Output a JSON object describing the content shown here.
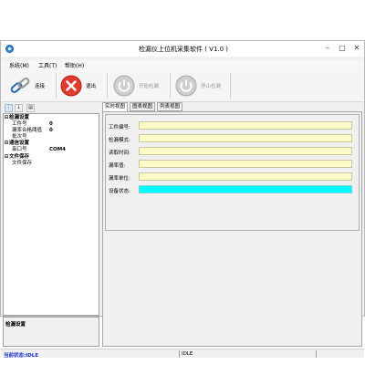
{
  "window": {
    "title": "检漏仪上位机采集软件 ( V1.0 )"
  },
  "menu": {
    "items": [
      "系统(M)",
      "工具(T)",
      "帮助(H)"
    ]
  },
  "toolbar": {
    "connect_label": "连接",
    "exit_label": "退出",
    "start_label": "开始检漏",
    "stop_label": "停止检漏"
  },
  "propgrid": {
    "categories": [
      {
        "name": "检漏设置",
        "props": [
          {
            "name": "工件号",
            "value": "0"
          },
          {
            "name": "漏率合格阈值",
            "value": "0"
          },
          {
            "name": "批次号",
            "value": ""
          }
        ]
      },
      {
        "name": "通信设置",
        "props": [
          {
            "name": "串口号",
            "value": "COM4"
          }
        ]
      },
      {
        "name": "文件保存",
        "props": [
          {
            "name": "文件保存",
            "value": ""
          }
        ]
      }
    ],
    "description_title": "检漏设置"
  },
  "tabs": [
    "实时视图",
    "图表视图",
    "列表视图"
  ],
  "fields": [
    {
      "label": "工件编号:",
      "value": ""
    },
    {
      "label": "检漏模式:",
      "value": ""
    },
    {
      "label": "读取时间:",
      "value": ""
    },
    {
      "label": "漏率值:",
      "value": ""
    },
    {
      "label": "漏率单位:",
      "value": ""
    },
    {
      "label": "设备状态:",
      "value": ""
    }
  ],
  "status": {
    "left": "当前状态:IDLE",
    "right": "IDLE"
  },
  "colors": {
    "field_bg": "#fdfbc6",
    "status_field_bg": "#00ffff",
    "status_text": "#1a2fd1"
  }
}
